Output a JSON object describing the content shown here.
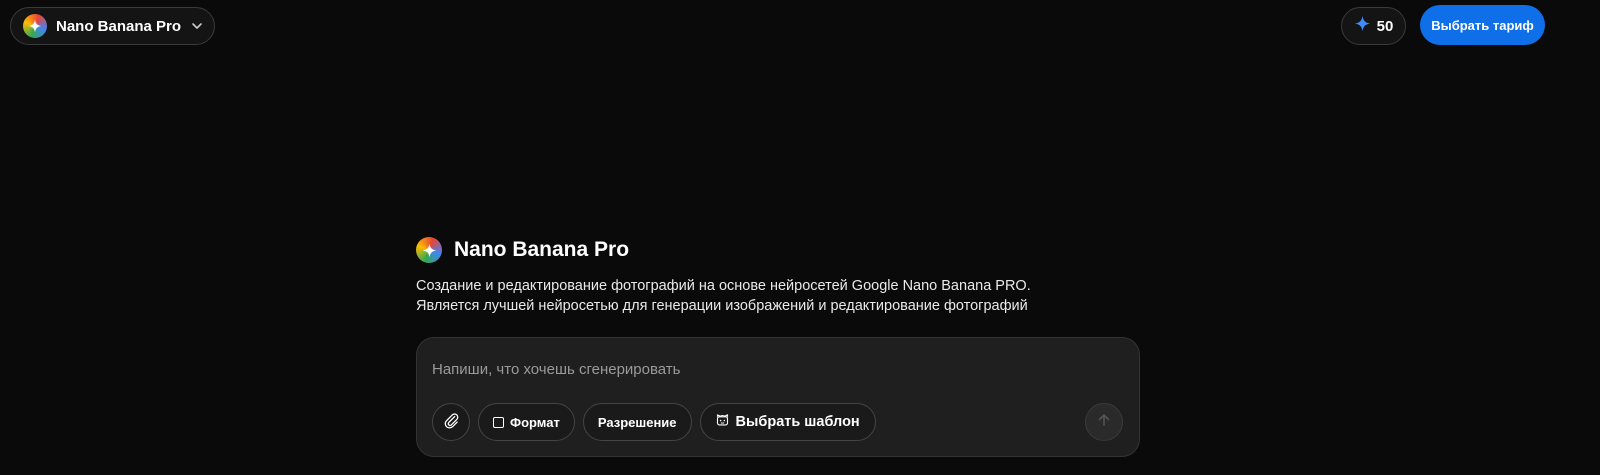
{
  "header": {
    "model_name": "Nano Banana Pro",
    "model_icon": "gemini-sparkle-icon",
    "credits": "50",
    "credits_icon": "sparkle-icon",
    "tariff_button": "Выбрать тариф"
  },
  "hero": {
    "title": "Nano Banana Pro",
    "description_line1": "Создание и редактирование фотографий на основе нейросетей Google Nano Banana PRO.",
    "description_line2": "Является лучшей нейросетью для генерации изображений и редактирование фотографий"
  },
  "prompt": {
    "placeholder": "Напиши, что хочешь сгенерировать",
    "value": "",
    "attach_icon": "paperclip-icon",
    "format_label": "Формат",
    "resolution_label": "Разрешение",
    "template_label": "Выбрать шаблон",
    "template_icon": "template-icon",
    "send_icon": "arrow-up-icon"
  },
  "colors": {
    "background": "#0a0a0a",
    "accent": "#0f6fe8",
    "panel": "#1f1f1f"
  }
}
